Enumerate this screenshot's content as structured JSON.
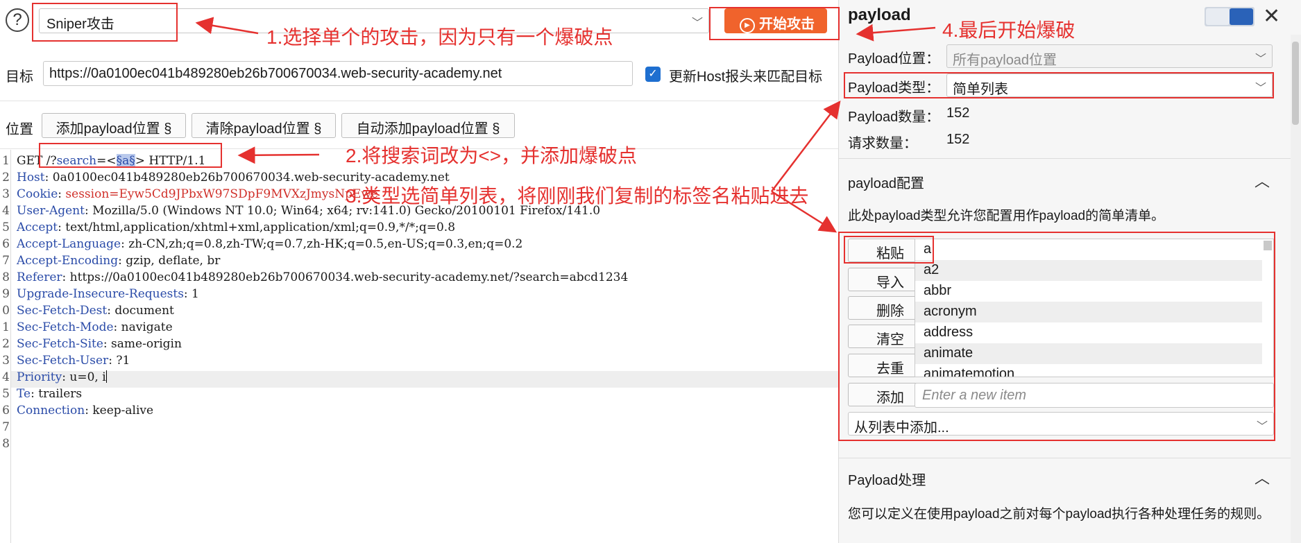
{
  "attack": {
    "type": "Sniper攻击",
    "start_label": "开始攻击"
  },
  "target": {
    "label": "目标",
    "url": "https://0a0100ec041b489280eb26b700670034.web-security-academy.net",
    "update_host_label": "更新Host报头来匹配目标"
  },
  "positions": {
    "label": "位置",
    "add_btn": "添加payload位置 §",
    "clear_btn": "清除payload位置 §",
    "auto_btn": "自动添加payload位置 §"
  },
  "editor": {
    "line_numbers": [
      "1",
      "2",
      "3",
      "4",
      "5",
      "6",
      "7",
      "8",
      "9",
      "0",
      "1",
      "2",
      "3",
      "4",
      "5",
      "6",
      "7",
      "8"
    ],
    "line1": {
      "method": "GET ",
      "path_prefix": "/?",
      "param": "search",
      "eq": "=<",
      "marker": "§a§",
      "suffix": "> HTTP/1.1"
    },
    "headers": [
      {
        "name": "Host",
        "value": " 0a0100ec041b489280eb26b700670034.web-security-academy.net"
      },
      {
        "name": "Cookie",
        "value": " session=Eyw5Cd9JPbxW97SDpF9MVXzJmysNpEwe"
      },
      {
        "name": "User-Agent",
        "value": " Mozilla/5.0 (Windows NT 10.0; Win64; x64; rv:141.0) Gecko/20100101 Firefox/141.0"
      },
      {
        "name": "Accept",
        "value": " text/html,application/xhtml+xml,application/xml;q=0.9,*/*;q=0.8"
      },
      {
        "name": "Accept-Language",
        "value": " zh-CN,zh;q=0.8,zh-TW;q=0.7,zh-HK;q=0.5,en-US;q=0.3,en;q=0.2"
      },
      {
        "name": "Accept-Encoding",
        "value": " gzip, deflate, br"
      },
      {
        "name": "Referer",
        "value": " https://0a0100ec041b489280eb26b700670034.web-security-academy.net/?search=abcd1234"
      },
      {
        "name": "Upgrade-Insecure-Requests",
        "value": " 1"
      },
      {
        "name": "Sec-Fetch-Dest",
        "value": " document"
      },
      {
        "name": "Sec-Fetch-Mode",
        "value": " navigate"
      },
      {
        "name": "Sec-Fetch-Site",
        "value": " same-origin"
      },
      {
        "name": "Sec-Fetch-User",
        "value": " ?1"
      },
      {
        "name": "Priority",
        "value": " u=0, i"
      },
      {
        "name": "Te",
        "value": " trailers"
      },
      {
        "name": "Connection",
        "value": " keep-alive"
      }
    ]
  },
  "panel": {
    "title": "payload",
    "payload_position_label": "Payload位置：",
    "payload_position_value": "所有payload位置",
    "payload_type_label": "Payload类型：",
    "payload_type_value": "简单列表",
    "payload_count_label": "Payload数量：",
    "payload_count_value": "152",
    "request_count_label": "请求数量：",
    "request_count_value": "152",
    "config_title": "payload配置",
    "config_desc": "此处payload类型允许您配置用作payload的简单清单。",
    "buttons": {
      "paste": "粘贴",
      "import": "导入",
      "delete": "删除",
      "clear": "清空",
      "dedupe": "去重",
      "add": "添加"
    },
    "items": [
      "a",
      "a2",
      "abbr",
      "acronym",
      "address",
      "animate",
      "animatemotion"
    ],
    "new_item_placeholder": "Enter a new item",
    "from_list": "从列表中添加...",
    "processing_title": "Payload处理",
    "processing_desc": "您可以定义在使用payload之前对每个payload执行各种处理任务的规则。"
  },
  "annotations": {
    "a1": "1.选择单个的攻击，因为只有一个爆破点",
    "a2": "2.将搜索词改为<>，并添加爆破点",
    "a3": "3.类型选简单列表，将刚刚我们复制的标签名粘贴进去",
    "a4": "4.最后开始爆破"
  },
  "colors": {
    "annotation": "#e5312f",
    "start_button": "#f0632c",
    "accent": "#1e6fd0"
  }
}
